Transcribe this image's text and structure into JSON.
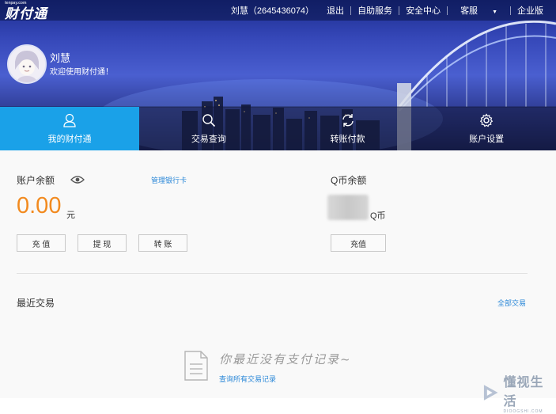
{
  "header": {
    "logo_text": "财付通",
    "logo_small": "tenpay.com",
    "user_id_label": "刘慧（2645436074）",
    "logout": "退出",
    "self_service": "自助服务",
    "security_center": "安全中心",
    "customer_service": "客服",
    "enterprise": "企业版"
  },
  "profile": {
    "name": "刘慧",
    "welcome": "欢迎使用财付通！"
  },
  "tabs": [
    {
      "label": "我的财付通",
      "icon": "user-icon",
      "active": true
    },
    {
      "label": "交易查询",
      "icon": "search-icon",
      "active": false
    },
    {
      "label": "转账付款",
      "icon": "transfer-icon",
      "active": false
    },
    {
      "label": "账户设置",
      "icon": "gear-icon",
      "active": false
    }
  ],
  "balance": {
    "title": "账户余额",
    "manage_bank": "管理银行卡",
    "amount": "0.00",
    "unit": "元",
    "buttons": {
      "recharge": "充 值",
      "withdraw": "提 现",
      "transfer": "转 账"
    }
  },
  "qcoin": {
    "title": "Q币余额",
    "unit": "Q币",
    "recharge": "充值"
  },
  "recent": {
    "title": "最近交易",
    "all_link": "全部交易",
    "empty_text": "你最近没有支付记录~",
    "query_link": "查询所有交易记录"
  },
  "watermark": {
    "name": "懂视生活",
    "sub": "DIOOGSHI.COM"
  },
  "colors": {
    "accent": "#1aa1e8",
    "amount": "#f28a1f",
    "link": "#2b88d8"
  }
}
